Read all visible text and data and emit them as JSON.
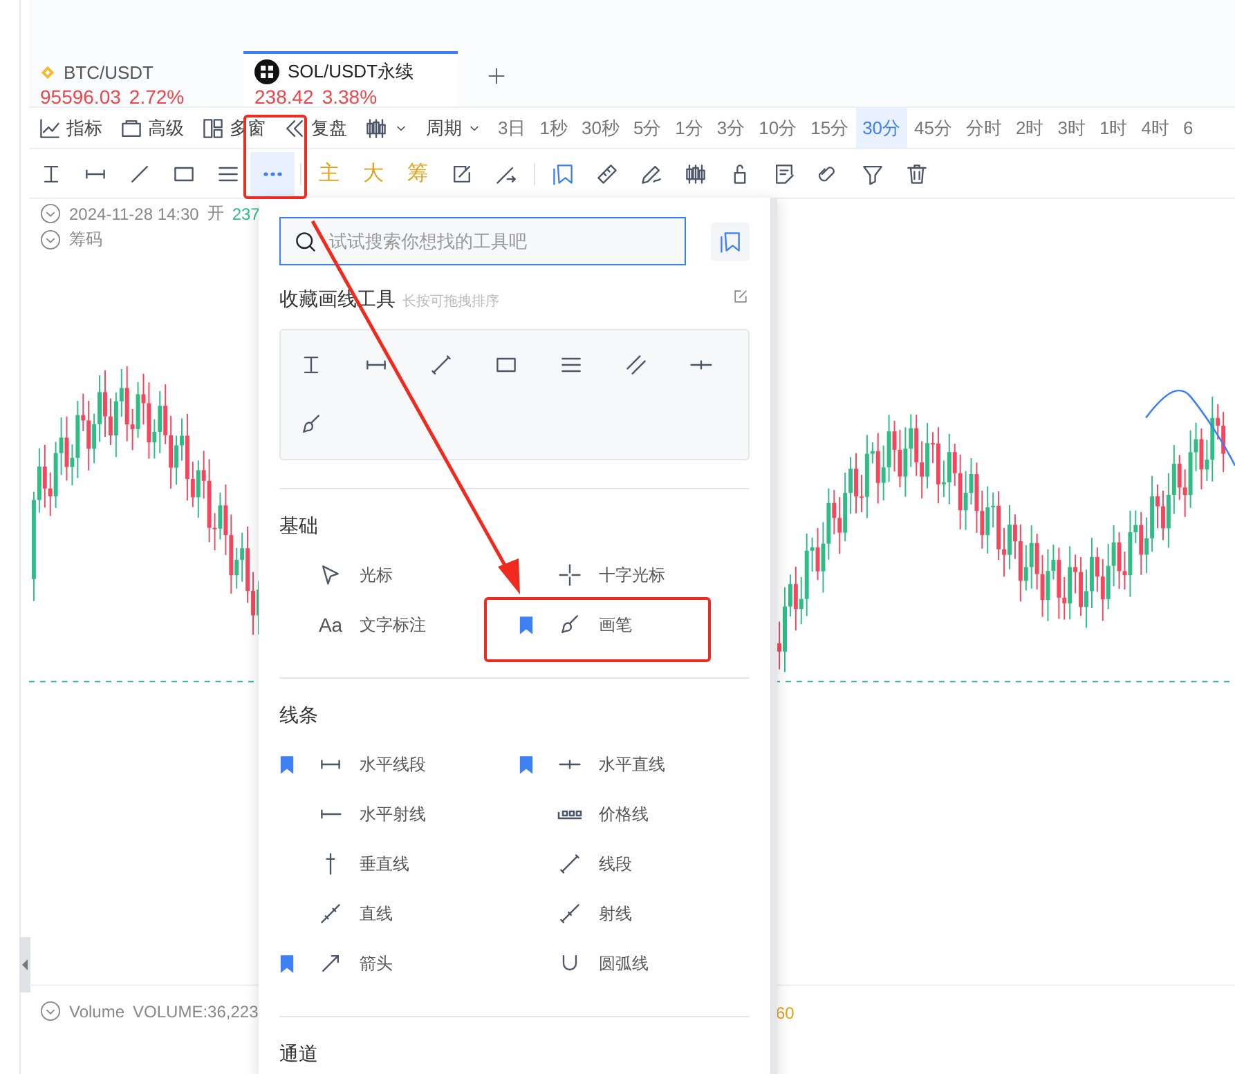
{
  "symbol_tabs": [
    {
      "kind": "diamond",
      "pair": "BTC/USDT",
      "price": "95596.03",
      "change": "2.72%",
      "selected": false
    },
    {
      "kind": "checker",
      "pair": "SOL/USDT永续",
      "price": "238.42",
      "change": "3.38%",
      "selected": true
    }
  ],
  "chart_toolbar": {
    "tools": [
      {
        "kind": "indicator",
        "label": "指标"
      },
      {
        "kind": "advanced",
        "label": "高级"
      },
      {
        "kind": "layout",
        "label": "多窗"
      },
      {
        "kind": "replay",
        "label": "复盘"
      },
      {
        "kind": "candles"
      },
      {
        "kind": "period",
        "label": "周期"
      }
    ],
    "periods": [
      {
        "label": "3日",
        "selected": false
      },
      {
        "label": "1秒",
        "selected": false
      },
      {
        "label": "30秒",
        "selected": false
      },
      {
        "label": "5分",
        "selected": false
      },
      {
        "label": "1分",
        "selected": false
      },
      {
        "label": "3分",
        "selected": false
      },
      {
        "label": "10分",
        "selected": false
      },
      {
        "label": "15分",
        "selected": false
      },
      {
        "label": "30分",
        "selected": true
      },
      {
        "label": "45分",
        "selected": false
      },
      {
        "label": "分时",
        "selected": false
      },
      {
        "label": "2时",
        "selected": false
      },
      {
        "label": "3时",
        "selected": false
      },
      {
        "label": "1时",
        "selected": false
      },
      {
        "label": "4时",
        "selected": false
      },
      {
        "label": "6",
        "selected": false
      }
    ]
  },
  "drawing_toolbar": [
    {
      "kind": "vseg",
      "selected": false
    },
    {
      "kind": "hseg",
      "selected": false
    },
    {
      "kind": "diag",
      "selected": false
    },
    {
      "kind": "rect",
      "selected": false
    },
    {
      "kind": "lines3",
      "selected": false
    },
    {
      "kind": "more",
      "selected": true
    },
    {
      "kind": "text",
      "label": "主",
      "selected": false
    },
    {
      "kind": "text",
      "label": "大",
      "selected": false
    },
    {
      "kind": "text",
      "label": "筹",
      "selected": false
    },
    {
      "kind": "editbox",
      "selected": false
    },
    {
      "kind": "linetool",
      "selected": false
    },
    {
      "kind": "favbook",
      "selected": false
    },
    {
      "kind": "ruler",
      "selected": false
    },
    {
      "kind": "pencil",
      "selected": false
    },
    {
      "kind": "candles",
      "selected": false
    },
    {
      "kind": "lock",
      "selected": false
    },
    {
      "kind": "note",
      "selected": false
    },
    {
      "kind": "magnet",
      "selected": false
    },
    {
      "kind": "filter",
      "selected": false
    },
    {
      "kind": "trash",
      "selected": false
    }
  ],
  "legend": {
    "date": "2024-11-28 14:30",
    "open_label": "开",
    "open_value": "237",
    "indicator": "筹码"
  },
  "volume_legend": {
    "name": "Volume",
    "reading": "VOLUME:36,223",
    "value": "60"
  },
  "tool_panel": {
    "search": {
      "placeholder": "试试搜索你想找的工具吧"
    },
    "favorites": {
      "title": "收藏画线工具",
      "hint": "长按可拖拽排序",
      "tools": [
        {
          "kind": "vseg"
        },
        {
          "kind": "hseg"
        },
        {
          "kind": "segment"
        },
        {
          "kind": "rect"
        },
        {
          "kind": "lines3"
        },
        {
          "kind": "channel"
        },
        {
          "kind": "hcross"
        },
        {
          "kind": "brush"
        }
      ]
    },
    "sections": [
      {
        "title": "基础",
        "items": [
          {
            "kind": "cursor",
            "label": "光标",
            "favorite": false
          },
          {
            "kind": "crosshair",
            "label": "十字光标",
            "favorite": false
          },
          {
            "kind": "glyph",
            "glyph": "Aa",
            "label": "文字标注",
            "favorite": false
          },
          {
            "kind": "brush",
            "label": "画笔",
            "favorite": true
          }
        ]
      },
      {
        "title": "线条",
        "items": [
          {
            "kind": "hseg",
            "label": "水平线段",
            "favorite": true
          },
          {
            "kind": "hcross",
            "label": "水平直线",
            "favorite": true
          },
          {
            "kind": "hray",
            "label": "水平射线",
            "favorite": false
          },
          {
            "kind": "priceline",
            "label": "价格线",
            "favorite": false
          },
          {
            "kind": "vline",
            "label": "垂直线",
            "favorite": false
          },
          {
            "kind": "segment",
            "label": "线段",
            "favorite": false
          },
          {
            "kind": "line",
            "label": "直线",
            "favorite": false
          },
          {
            "kind": "ray",
            "label": "射线",
            "favorite": false
          },
          {
            "kind": "arrow",
            "label": "箭头",
            "favorite": true
          },
          {
            "kind": "arc",
            "label": "圆弧线",
            "favorite": false
          }
        ]
      },
      {
        "title": "通道"
      }
    ]
  }
}
